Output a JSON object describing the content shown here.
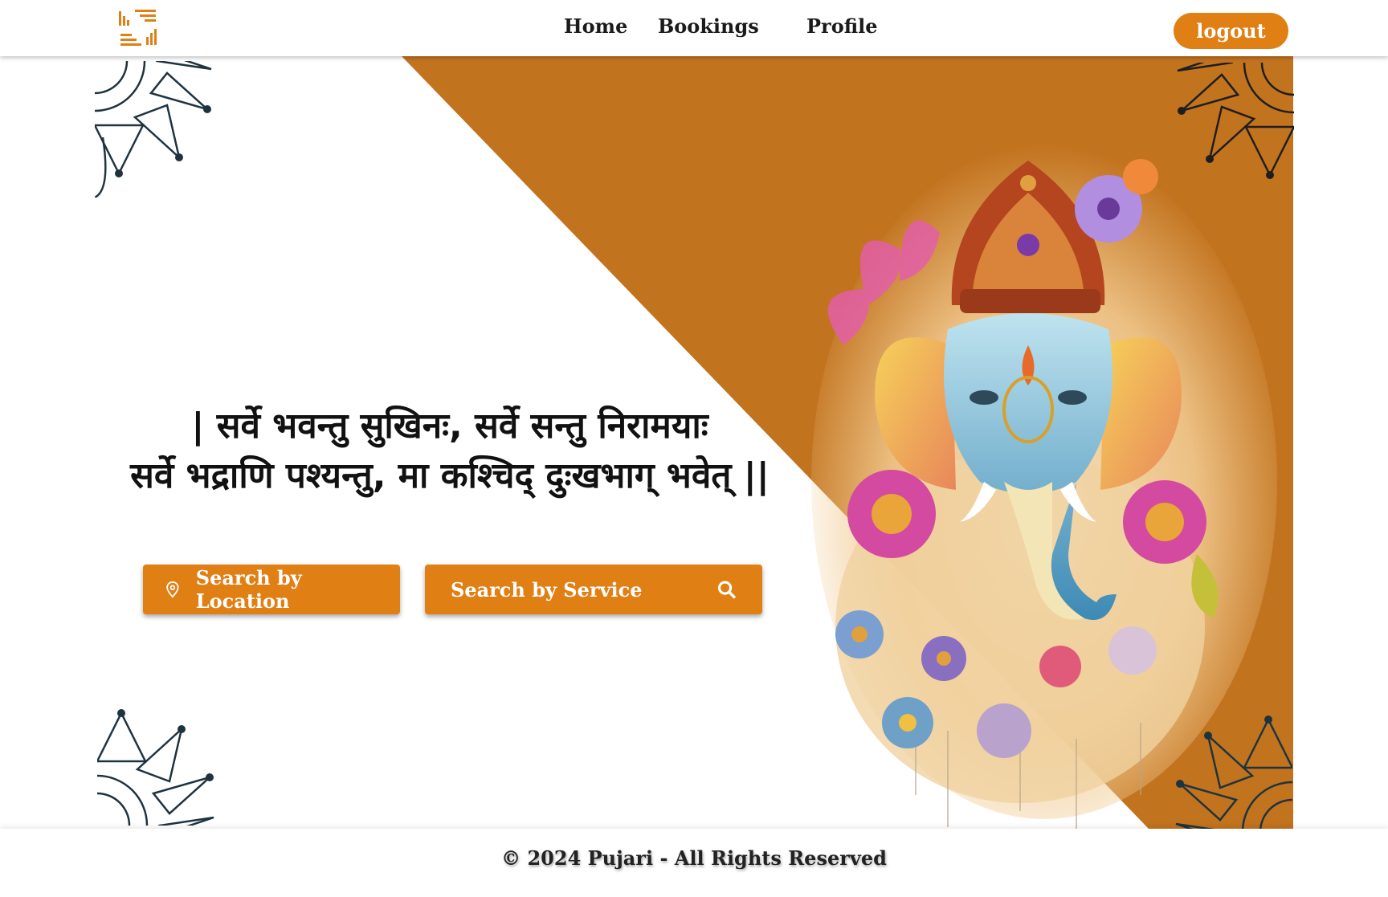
{
  "header": {
    "nav": {
      "home": "Home",
      "bookings": "Bookings",
      "profile": "Profile"
    },
    "logout_label": "logout"
  },
  "hero": {
    "shloka_line1": "| सर्वे भवन्तु सुखिनः, सर्वे सन्तु निरामयाः",
    "shloka_line2": "सर्वे भद्राणि पश्यन्तु, मा कश्चिद् दुःखभाग् भवेत्  ||",
    "search_location_label": "Search by Location",
    "search_service_placeholder": "Search by Service"
  },
  "footer": {
    "copyright": "© 2024 Pujari - All Rights Reserved"
  },
  "colors": {
    "accent": "#e07f14",
    "hero_diagonal": "#c2731e",
    "mandala_dark": "#1e3340",
    "text": "#111111"
  },
  "icons": {
    "logo": "pujari-logo-icon",
    "location": "map-pin-icon",
    "search": "search-icon",
    "mandala": "mandala-icon",
    "ganesha": "ganesha-illustration"
  }
}
